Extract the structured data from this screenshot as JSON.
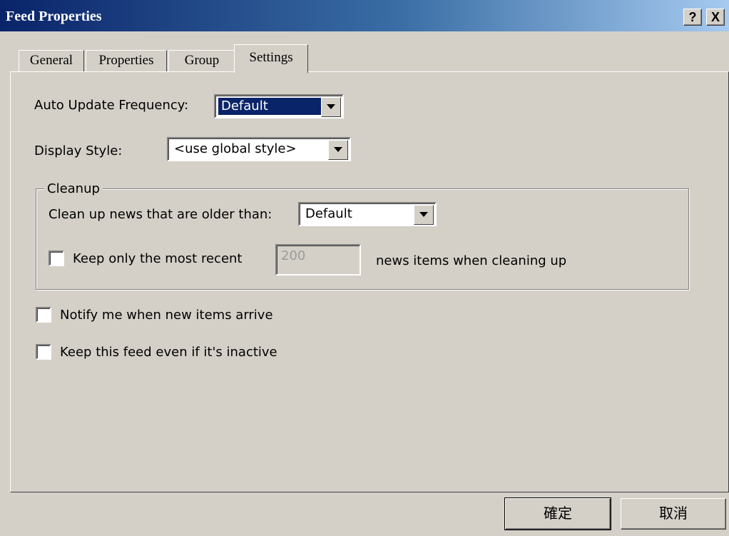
{
  "window": {
    "title": "Feed Properties",
    "help_label": "?",
    "close_label": "X"
  },
  "tabs": [
    {
      "label": "General"
    },
    {
      "label": "Properties"
    },
    {
      "label": "Group"
    },
    {
      "label": "Settings",
      "selected": true
    }
  ],
  "settings": {
    "auto_update_label": "Auto Update Frequency:",
    "auto_update_value": "Default",
    "display_style_label": "Display Style:",
    "display_style_value": "<use global style>",
    "cleanup": {
      "legend": "Cleanup",
      "older_than_label": "Clean up news that are older than:",
      "older_than_value": "Default",
      "keep_recent_label": "Keep only the most recent",
      "keep_recent_checked": false,
      "keep_recent_value": "200",
      "keep_recent_suffix": "news items when cleaning up"
    },
    "notify_label": "Notify me when new items arrive",
    "notify_checked": false,
    "keep_inactive_label": "Keep this feed even if it's inactive",
    "keep_inactive_checked": false
  },
  "buttons": {
    "ok_label": "確定",
    "cancel_label": "取消"
  },
  "colors": {
    "titlebar_start": "#0a246a",
    "titlebar_end": "#a6caf0",
    "face": "#d4d0c8",
    "selection": "#0a246a"
  }
}
